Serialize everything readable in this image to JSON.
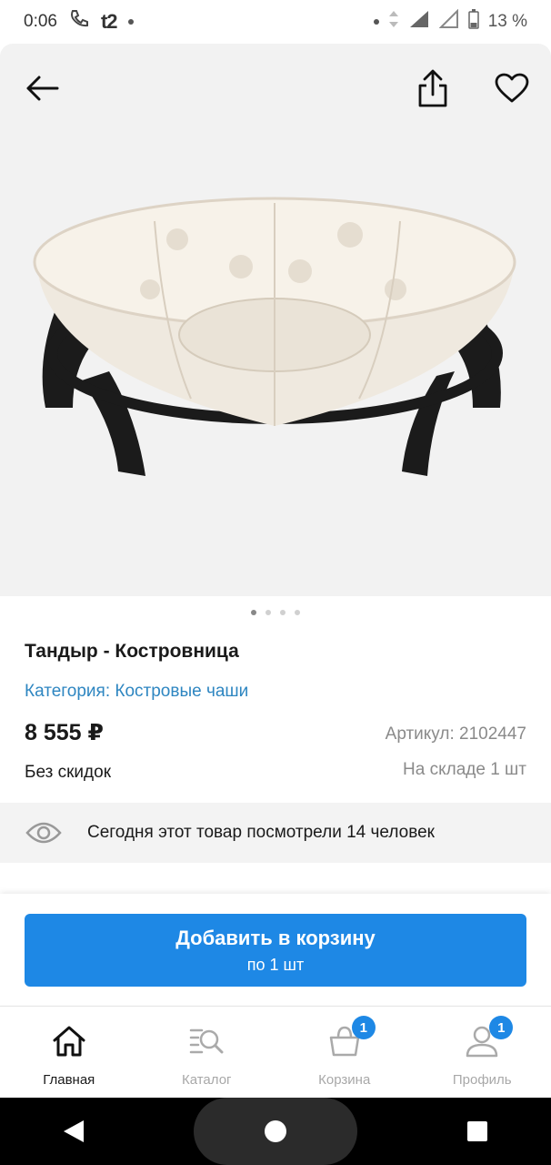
{
  "status_bar": {
    "time": "0:06",
    "carrier": "t2",
    "battery": "13 %"
  },
  "product": {
    "title": "Тандыр - Костровница",
    "category": "Категория: Костровые чаши",
    "price": "8 555 ₽",
    "article": "Артикул: 2102447",
    "discount": "Без скидок",
    "stock": "На складе 1 шт",
    "image_count": 4,
    "active_image": 1
  },
  "views": {
    "text": "Сегодня этот товар посмотрели 14 человек"
  },
  "cart_button": {
    "label": "Добавить в корзину",
    "sublabel": "по 1 шт"
  },
  "tabs": [
    {
      "label": "Главная",
      "icon": "home-icon",
      "active": true
    },
    {
      "label": "Каталог",
      "icon": "catalog-search-icon",
      "active": false
    },
    {
      "label": "Корзина",
      "icon": "basket-icon",
      "active": false,
      "badge": "1"
    },
    {
      "label": "Профиль",
      "icon": "profile-icon",
      "active": false,
      "badge": "1"
    }
  ],
  "colors": {
    "accent": "#1e88e5",
    "link": "#2e86c1",
    "muted": "#8a8a8a"
  }
}
